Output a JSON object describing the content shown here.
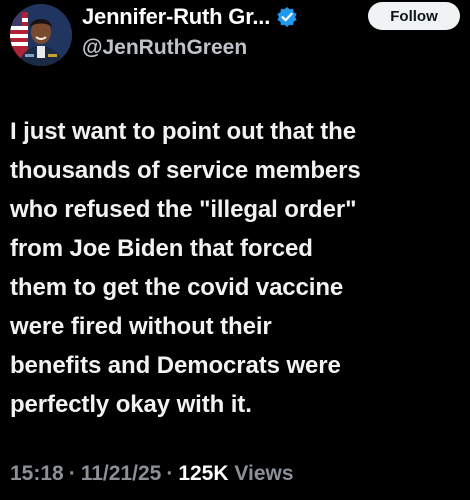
{
  "author": {
    "display_name": "Jennifer-Ruth Gr...",
    "handle": "@JenRuthGreen",
    "verified": true
  },
  "follow_button": {
    "label": "Follow"
  },
  "tweet": {
    "lines": [
      "I just want to point out that the",
      "thousands of service members",
      "who refused the \"illegal order\"",
      "from Joe Biden that forced",
      "them to get the covid vaccine",
      "were fired without their",
      "benefits and Democrats were",
      "perfectly okay with it."
    ]
  },
  "meta": {
    "time": "15:18",
    "separator": "·",
    "date": "11/21/25",
    "views_count": "125K",
    "views_label": "Views"
  },
  "colors": {
    "background": "#000000",
    "verified_badge": "#1d9bf0",
    "follow_bg": "#eff3f4"
  },
  "icons": {
    "verified": "verified-badge-icon",
    "avatar": "profile-photo"
  }
}
